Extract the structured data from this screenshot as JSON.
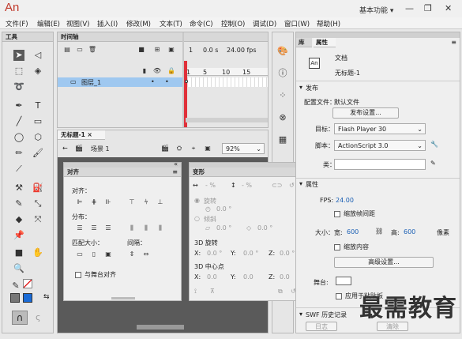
{
  "app": {
    "logo": "An",
    "workspace": "基本功能 ▾",
    "min": "—",
    "max": "❐",
    "close": "✕"
  },
  "menu": [
    "文件(F)",
    "编辑(E)",
    "视图(V)",
    "插入(I)",
    "修改(M)",
    "文本(T)",
    "命令(C)",
    "控制(O)",
    "调试(D)",
    "窗口(W)",
    "帮助(H)"
  ],
  "tools": {
    "title": "工具"
  },
  "timeline": {
    "tab": "时间轴",
    "frame": "1",
    "time": "0.0 s",
    "fps": "24.00 fps",
    "ruler": [
      "1",
      "5",
      "10",
      "15"
    ],
    "layer": "图层_1"
  },
  "stage": {
    "tab": "无标题-1 ×",
    "scene": "场景 1",
    "zoom": "92%"
  },
  "align": {
    "tab": "对齐",
    "align_label": "对齐：",
    "distribute_label": "分布：",
    "match_label": "匹配大小：",
    "space_label": "间隔：",
    "to_stage": "与舞台对齐"
  },
  "transform": {
    "tab": "变形",
    "w": "- %",
    "h": "- %",
    "rotate": "旋转",
    "rotate_val": "0.0 °",
    "skew": "倾斜",
    "skew1": "0.0 °",
    "skew2": "0.0 °",
    "r3d": "3D 旋转",
    "x": "X:",
    "y": "Y:",
    "z": "Z:",
    "rx": "0.0 °",
    "ry": "0.0 °",
    "rz": "0.0 °",
    "center": "3D 中心点",
    "cx": "0.0",
    "cy": "0.0",
    "cz": "0.0"
  },
  "props": {
    "tab_lib": "库",
    "tab_props": "属性",
    "doc_icon": "An",
    "doc_type": "文档",
    "doc_name": "无标题-1",
    "publish_hdr": "发布",
    "profile_label": "配置文件：",
    "profile_val": "默认文件",
    "publish_settings": "发布设置...",
    "target_label": "目标：",
    "target_val": "Flash Player 30",
    "script_label": "脚本：",
    "script_val": "ActionScript 3.0",
    "class_label": "类：",
    "props_hdr": "属性",
    "fps_label": "FPS:",
    "fps_val": "24.00",
    "scale_span": "缩放帧间距",
    "size_label": "大小：",
    "w_label": "宽:",
    "w_val": "600",
    "h_label": "高:",
    "h_val": "600",
    "unit": "像素",
    "scale_content": "缩放内容",
    "advanced": "高级设置...",
    "stage_label": "舞台:",
    "apply_paste": "应用于粘贴板",
    "swf_hdr": "SWF 历史记录",
    "log": "日志",
    "clear": "清除"
  },
  "watermark": "最需教育"
}
